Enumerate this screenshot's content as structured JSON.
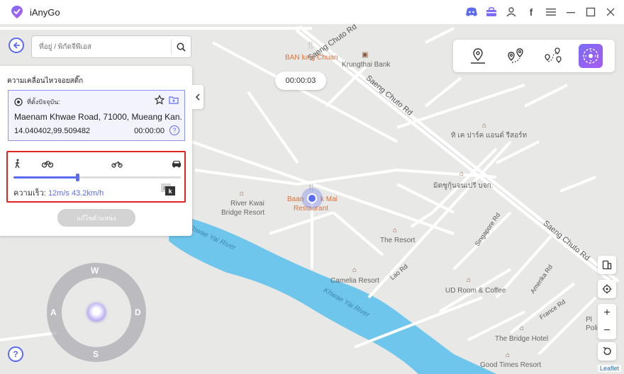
{
  "app": {
    "title": "iAnyGo"
  },
  "search": {
    "placeholder": "ที่อยู่ / พิกัดจีพีเอส"
  },
  "timer": "00:00:03",
  "panel": {
    "title": "ความเคลื่อนไหวจอยสติ๊ก",
    "current_location_label": "ที่ตั้งปัจจุบัน:",
    "address": "Maenam Khwae Road, 71000, Mueang Kan...",
    "coordinates": "14.040402,99.509482",
    "time": "00:00:00",
    "speed_label": "ความเร็ว:",
    "speed_value": "12m/s 43.2km/h",
    "speed_fraction": 0.38,
    "unit_m": "m",
    "unit_k": "k",
    "modify_button": "แก้ไขตำแหน่ง"
  },
  "joystick": {
    "north": "W",
    "south": "S",
    "west": "A",
    "east": "D"
  },
  "map_labels": {
    "ban_lung_chuan": "BAN lung Chuan",
    "krungthai": "Krungthai Bank",
    "saeng_chuto_1": "Saeng Chuto Rd",
    "saeng_chuto_2": "Saeng Chuto Rd",
    "saeng_chuto_3": "Saeng Chuto Rd",
    "tk_park": "ทิ เค ปาร์ค แอนด์ รีสอร์ท",
    "mitchuchon": "มิตซูกุ้นจนเปรี บจก.",
    "river_kwai_1": "River Kwai",
    "river_kwai_2": "Bridge Resort",
    "baan_mai_1": "Baan Mai",
    "baan_mai_pre": "Baan",
    "baan_mai_post": "k Mai",
    "baan_mai_2": "Restaurant",
    "the_resort": "The Resort",
    "singapore_rd": "Singapore Rd",
    "kwae_yai_1": "Khwae Yai River",
    "kwae_yai_2": "Khwae Yai River",
    "camelia": "Camelia Resort",
    "lao_rd": "Lao Rd",
    "ud_room": "UD Room & Coffee",
    "amerika_rd": "Amerika Rd",
    "france_rd": "France Rd",
    "bridge_hotel": "The Bridge Hotel",
    "good_times": "Good Times Resort",
    "pl_1": "Pl",
    "pl_2": "Poli"
  },
  "attribution": "Leaflet"
}
